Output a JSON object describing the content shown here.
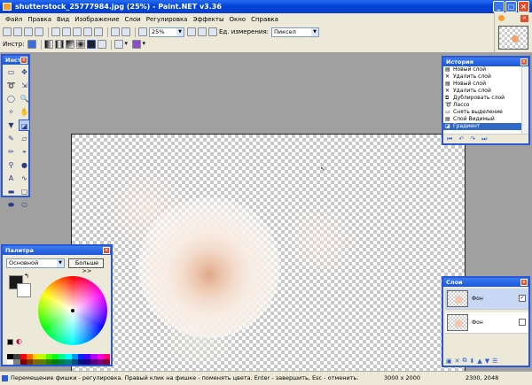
{
  "window": {
    "title": "shutterstock_25777984.jpg (25%) - Paint.NET v3.36"
  },
  "menu": [
    "Файл",
    "Правка",
    "Вид",
    "Изображение",
    "Слои",
    "Регулировка",
    "Эффекты",
    "Окно",
    "Справка"
  ],
  "toolbar": {
    "zoom": "25%",
    "units_label": "Ед. измерения:",
    "units_value": "Пиксел",
    "tools_label": "Инстр:"
  },
  "tools_panel": {
    "title": "Инст",
    "tools": [
      "select-rect",
      "move-selection",
      "lasso",
      "move-selected",
      "ellipse-select",
      "zoom",
      "magic-wand",
      "pan",
      "paint-bucket",
      "gradient",
      "paintbrush",
      "eraser",
      "pencil",
      "color-picker",
      "clone-stamp",
      "recolor",
      "text",
      "line-curve",
      "rectangle",
      "rounded-rectangle",
      "ellipse",
      "freeform-shape"
    ],
    "selected": "gradient"
  },
  "history": {
    "title": "История",
    "items": [
      {
        "icon": "layer-icon",
        "label": "Новый слой"
      },
      {
        "icon": "delete-icon",
        "label": "Удалить слой"
      },
      {
        "icon": "layer-icon",
        "label": "Новый слой"
      },
      {
        "icon": "delete-icon",
        "label": "Удалить слой"
      },
      {
        "icon": "duplicate-icon",
        "label": "Дублировать слой"
      },
      {
        "icon": "lasso-icon",
        "label": "Лассо"
      },
      {
        "icon": "deselect-icon",
        "label": "Снять выделение"
      },
      {
        "icon": "layer-icon",
        "label": "Слой Видимый"
      },
      {
        "icon": "gradient-icon",
        "label": "Градиент"
      }
    ],
    "current": 8
  },
  "palette": {
    "title": "Палитра",
    "mode": "Основной",
    "more_button": "Больше >>",
    "primary_color": "#1a1a1a",
    "secondary_color": "#ffffff",
    "swatches": [
      "#000000",
      "#404040",
      "#ff0000",
      "#ff6a00",
      "#ffd800",
      "#b6ff00",
      "#4cff00",
      "#00ff21",
      "#00ff90",
      "#00ffff",
      "#0094ff",
      "#0026ff",
      "#4800ff",
      "#b200ff",
      "#ff00dc",
      "#ff006e",
      "#ffffff",
      "#808080",
      "#7f0000",
      "#7f3300",
      "#7f6a00",
      "#5b7f00",
      "#267f00",
      "#007f0e",
      "#007f46",
      "#007f7f",
      "#004a7f",
      "#00137f",
      "#21007f",
      "#57007f",
      "#7f006e",
      "#7f0037"
    ]
  },
  "layers": {
    "title": "Слои",
    "items": [
      {
        "name": "Фон",
        "visible": true,
        "selected": true
      },
      {
        "name": "Фон",
        "visible": false,
        "selected": false
      }
    ]
  },
  "status": {
    "message": "Перемещение фишки - регулировка. Правый клик на фишке - поменять цвета. Enter - завершить, Esc - отменить.",
    "image_size": "3000 x 2000",
    "coords": "2300, 2048"
  }
}
